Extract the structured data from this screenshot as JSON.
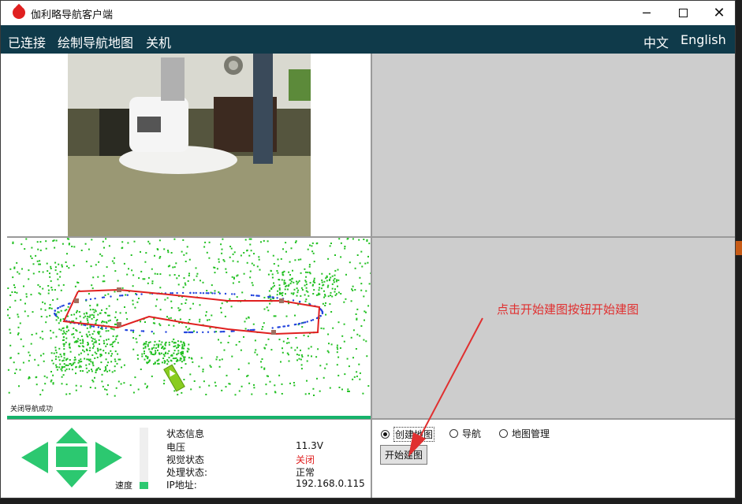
{
  "window": {
    "title": "伽利略导航客户端",
    "minimize_glyph": "─",
    "close_glyph": "✕"
  },
  "menu": {
    "connected": "已连接",
    "draw_map": "绘制导航地图",
    "shutdown": "关机",
    "lang_chinese": "中文",
    "lang_english": "English"
  },
  "map_view": {
    "status_message": "关闭导航成功"
  },
  "annotation": {
    "text": "点击开始建图按钮开始建图"
  },
  "control": {
    "speed_label": "速度",
    "speed_level": 0.12
  },
  "status": {
    "title": "状态信息",
    "voltage_label": "电压",
    "voltage_value": "11.3V",
    "vision_label": "视觉状态",
    "vision_value": "关闭",
    "processing_label": "处理状态:",
    "processing_value": "正常",
    "ip_label": "IP地址:",
    "ip_value": "192.168.0.115"
  },
  "modes": {
    "create_map": "创建地图",
    "navigate": "导航",
    "map_manage": "地图管理",
    "selected": "create_map",
    "start_mapping_button": "开始建图"
  },
  "colors": {
    "menubar": "#0f3a4a",
    "accent_green": "#2cc870",
    "path_red": "#e02020",
    "map_points_green": "#22c022",
    "map_points_blue": "#2244dd",
    "annotation_red": "#e03030"
  }
}
